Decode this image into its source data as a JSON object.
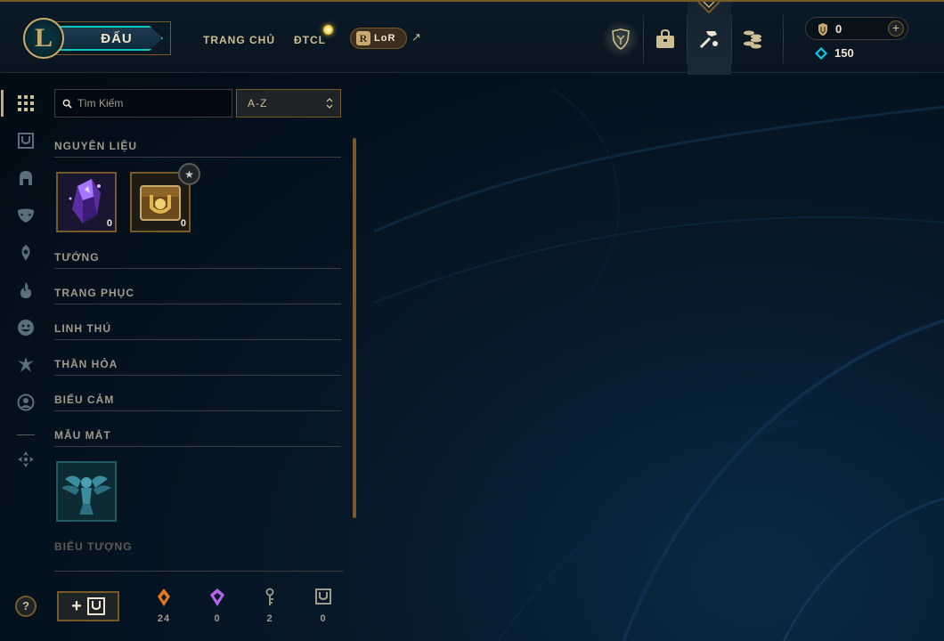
{
  "header": {
    "logo_letter": "L",
    "play_label": "ĐẤU",
    "nav": [
      {
        "label": "TRANG CHỦ"
      },
      {
        "label": "ĐTCL"
      }
    ],
    "lor_label": "LoR",
    "lor_icon_letter": "R",
    "external_arrow": "↗",
    "riot_points": "0",
    "blue_essence": "150",
    "plus_symbol": "+"
  },
  "icons": {
    "top": [
      "trophy-shield-icon",
      "store-bag-icon",
      "loot-crafting-icon",
      "currency-coins-icon"
    ],
    "rail": [
      "grid-icon",
      "chest-icon",
      "helmet-icon",
      "mask-icon",
      "ward-icon",
      "flame-icon",
      "emote-icon",
      "eternals-icon",
      "profile-icon",
      "bottom-arrows-icon"
    ]
  },
  "search": {
    "placeholder": "Tìm Kiếm",
    "sort_value": "A-Z"
  },
  "inventory": {
    "sections": [
      {
        "title": "NGUYÊN LIỆU"
      },
      {
        "title": "TƯỚNG"
      },
      {
        "title": "TRANG PHỤC"
      },
      {
        "title": "LINH THÚ"
      },
      {
        "title": "THẦN HỎA"
      },
      {
        "title": "BIỂU CẢM"
      },
      {
        "title": "MẪU MẮT"
      },
      {
        "title": "BIỂU TƯỢNG"
      }
    ],
    "materials": [
      {
        "name": "mythic-essence",
        "count": "0"
      },
      {
        "name": "hextech-chest",
        "count": "0"
      }
    ],
    "star_symbol": "★"
  },
  "footer": {
    "help_label": "?",
    "add_label": "+",
    "stats": [
      {
        "icon": "orange-essence-icon",
        "value": "24"
      },
      {
        "icon": "mythic-essence-icon",
        "value": "0"
      },
      {
        "icon": "key-icon",
        "value": "2"
      },
      {
        "icon": "chest-count-icon",
        "value": "0"
      }
    ]
  },
  "colors": {
    "gold": "#c8aa6e",
    "gold_dark": "#785a28",
    "text": "#cdbe91",
    "teal": "#0ac8b9",
    "background": "#010a13"
  }
}
